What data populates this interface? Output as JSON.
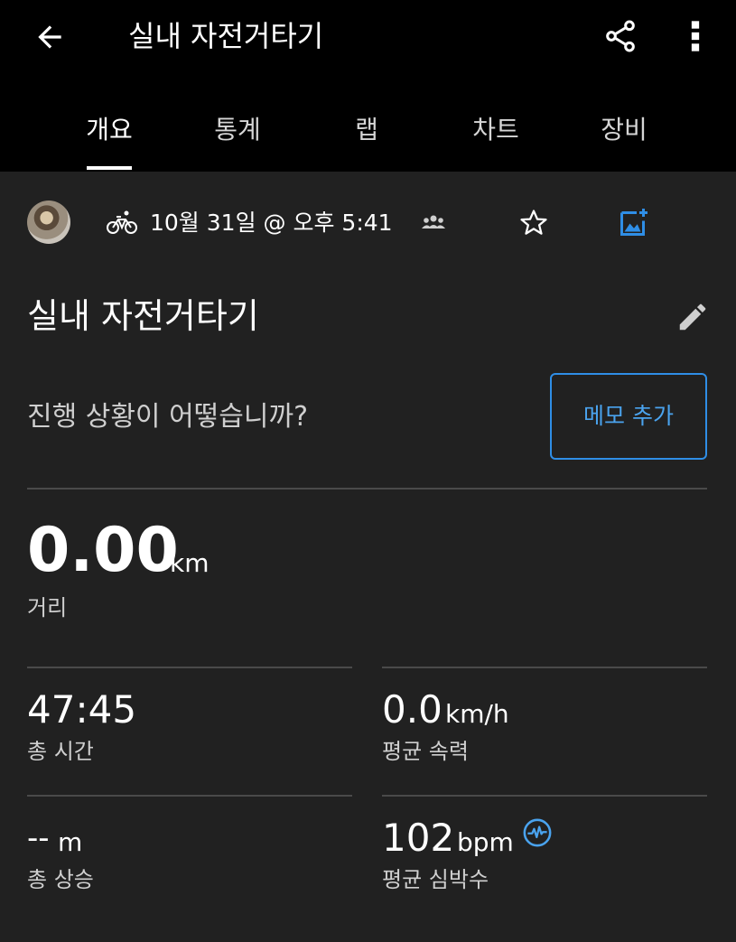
{
  "appbar": {
    "title": "실내 자전거타기",
    "back_icon": "arrow-back-icon",
    "share_icon": "share-icon",
    "more_icon": "more-vert-icon"
  },
  "tabs": [
    {
      "label": "개요",
      "active": true
    },
    {
      "label": "통계",
      "active": false
    },
    {
      "label": "랩",
      "active": false
    },
    {
      "label": "차트",
      "active": false
    },
    {
      "label": "장비",
      "active": false
    }
  ],
  "activity": {
    "type_icon": "bicycle-icon",
    "datetime": "10월 31일 @ 오후 5:41",
    "name": "실내 자전거타기",
    "prompt": "진행 상황이 어떻습니까?",
    "memo_button": "메모 추가"
  },
  "distance": {
    "value": "0.00",
    "unit": "km",
    "label": "거리"
  },
  "stats": {
    "total_time": {
      "value": "47:45",
      "label": "총 시간"
    },
    "avg_speed": {
      "value": "0.0",
      "unit": "km/h",
      "label": "평균 속력"
    },
    "total_ascent": {
      "value": "--",
      "unit": "m",
      "label": "총 상승"
    },
    "avg_hr": {
      "value": "102",
      "unit": "bpm",
      "label": "평균 심박수"
    }
  },
  "colors": {
    "background": "#212121",
    "appbar": "#000000",
    "accent": "#2f8ee6",
    "divider": "#4a4a4a"
  }
}
